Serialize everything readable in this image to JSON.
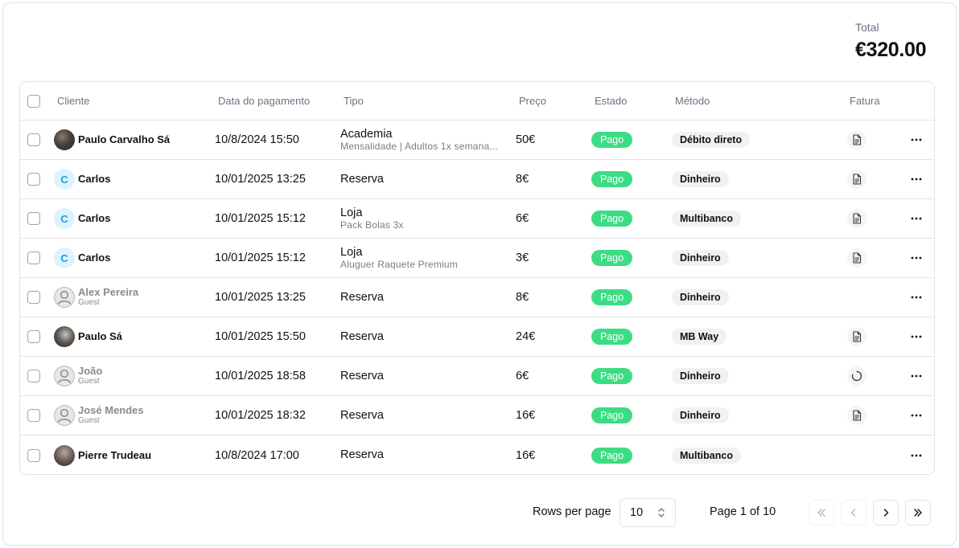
{
  "total": {
    "label": "Total",
    "value": "€320.00"
  },
  "table": {
    "headers": {
      "client": "Cliente",
      "date": "Data do pagamento",
      "type": "Tipo",
      "price": "Preço",
      "status": "Estado",
      "method": "Método",
      "invoice": "Fatura"
    },
    "rows": [
      {
        "client": "Paulo Carvalho Sá",
        "client_sub": "",
        "avatar": "photo",
        "initial": "",
        "date": "10/8/2024 15:50",
        "type": "Academia",
        "type_sub": "Mensalidade | Adultos 1x semana...",
        "price": "50€",
        "status": "Pago",
        "method": "Débito direto",
        "invoice": "document-icon"
      },
      {
        "client": "Carlos",
        "client_sub": "",
        "avatar": "initial",
        "initial": "C",
        "date": "10/01/2025 13:25",
        "type": "Reserva",
        "type_sub": "",
        "price": "8€",
        "status": "Pago",
        "method": "Dinheiro",
        "invoice": "document-icon"
      },
      {
        "client": "Carlos",
        "client_sub": "",
        "avatar": "initial",
        "initial": "C",
        "date": "10/01/2025 15:12",
        "type": "Loja",
        "type_sub": "Pack Bolas 3x",
        "price": "6€",
        "status": "Pago",
        "method": "Multibanco",
        "invoice": "document-icon"
      },
      {
        "client": "Carlos",
        "client_sub": "",
        "avatar": "initial",
        "initial": "C",
        "date": "10/01/2025 15:12",
        "type": "Loja",
        "type_sub": "Aluguer Raquete Premium",
        "price": "3€",
        "status": "Pago",
        "method": "Dinheiro",
        "invoice": "document-icon"
      },
      {
        "client": "Alex Pereira",
        "client_sub": "Guest",
        "avatar": "guest",
        "initial": "",
        "date": "10/01/2025 13:25",
        "type": "Reserva",
        "type_sub": "",
        "price": "8€",
        "status": "Pago",
        "method": "Dinheiro",
        "invoice": ""
      },
      {
        "client": "Paulo Sá",
        "client_sub": "",
        "avatar": "photo2",
        "initial": "",
        "date": "10/01/2025 15:50",
        "type": "Reserva",
        "type_sub": "",
        "price": "24€",
        "status": "Pago",
        "method": "MB Way",
        "invoice": "document-icon"
      },
      {
        "client": "João",
        "client_sub": "Guest",
        "avatar": "guest",
        "initial": "",
        "date": "10/01/2025 18:58",
        "type": "Reserva",
        "type_sub": "",
        "price": "6€",
        "status": "Pago",
        "method": "Dinheiro",
        "invoice": "spinner-icon"
      },
      {
        "client": "José Mendes",
        "client_sub": "Guest",
        "avatar": "guest",
        "initial": "",
        "date": "10/01/2025 18:32",
        "type": "Reserva",
        "type_sub": "",
        "price": "16€",
        "status": "Pago",
        "method": "Dinheiro",
        "invoice": "document-icon"
      },
      {
        "client": "Pierre Trudeau",
        "client_sub": "",
        "avatar": "photo3",
        "initial": "",
        "date": "10/8/2024 17:00",
        "type": "Reserva",
        "type_sub": "",
        "price": "16€",
        "status": "Pago",
        "method": "Multibanco",
        "invoice": ""
      }
    ]
  },
  "pagination": {
    "rows_label": "Rows per page",
    "rows_value": "10",
    "page_label": "Page 1 of 10"
  },
  "colors": {
    "status_green": "#3ddc84",
    "initial_avatar_bg": "#e0f2fe",
    "initial_avatar_fg": "#0ea5e9",
    "pill_bg": "#f1f1f3",
    "border": "#e4e4e7"
  },
  "icons": {
    "row_actions": "more-horizontal-icon",
    "rows_select": "chevron-up-down-icon",
    "first_page": "chevrons-left-icon",
    "prev_page": "chevron-left-icon",
    "next_page": "chevron-right-icon",
    "last_page": "chevrons-right-icon"
  }
}
